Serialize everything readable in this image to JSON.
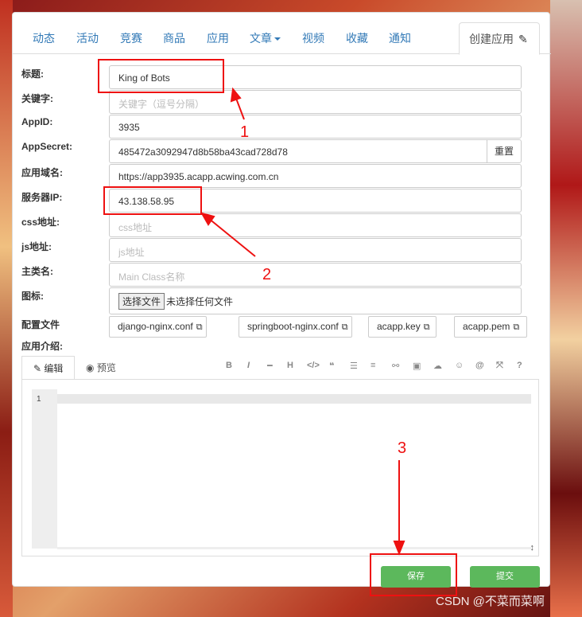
{
  "nav": {
    "items": [
      "动态",
      "活动",
      "竞赛",
      "商品",
      "应用",
      "文章",
      "视频",
      "收藏",
      "通知"
    ],
    "create_label": "创建应用"
  },
  "form": {
    "title_label": "标题:",
    "title_value": "King of Bots",
    "keywords_label": "关键字:",
    "keywords_placeholder": "关键字（逗号分隔）",
    "appid_label": "AppID:",
    "appid_value": "3935",
    "secret_label": "AppSecret:",
    "secret_value": "485472a3092947d8b58ba43cad728d78",
    "reset_label": "重置",
    "domain_label": "应用域名:",
    "domain_value": "https://app3935.acapp.acwing.com.cn",
    "ip_label": "服务器IP:",
    "ip_value": "43.138.58.95",
    "css_label": "css地址:",
    "css_placeholder": "css地址",
    "js_label": "js地址:",
    "js_placeholder": "js地址",
    "main_label": "主类名:",
    "main_placeholder": "Main Class名称",
    "icon_label": "图标:",
    "file_button": "选择文件",
    "file_status": "未选择任何文件",
    "config_label": "配置文件",
    "config_files": [
      "django-nginx.conf",
      "springboot-nginx.conf",
      "acapp.key",
      "acapp.pem"
    ],
    "intro_label": "应用介绍:"
  },
  "editor": {
    "tab_edit": "编辑",
    "tab_preview": "预览",
    "toolbar_icons": [
      "bold-icon",
      "italic-icon",
      "hr-icon",
      "heading-icon",
      "code-icon",
      "quote-icon",
      "ul-icon",
      "ol-icon",
      "link-icon",
      "image-icon",
      "upload-icon",
      "emoji-icon",
      "at-icon",
      "fullscreen-icon",
      "help-icon"
    ],
    "line_number": "1"
  },
  "buttons": {
    "save": "保存",
    "submit": "提交"
  },
  "annotations": {
    "n1": "1",
    "n2": "2",
    "n3": "3",
    "color": "#ee1111"
  },
  "watermark": "CSDN @不菜而菜啊"
}
